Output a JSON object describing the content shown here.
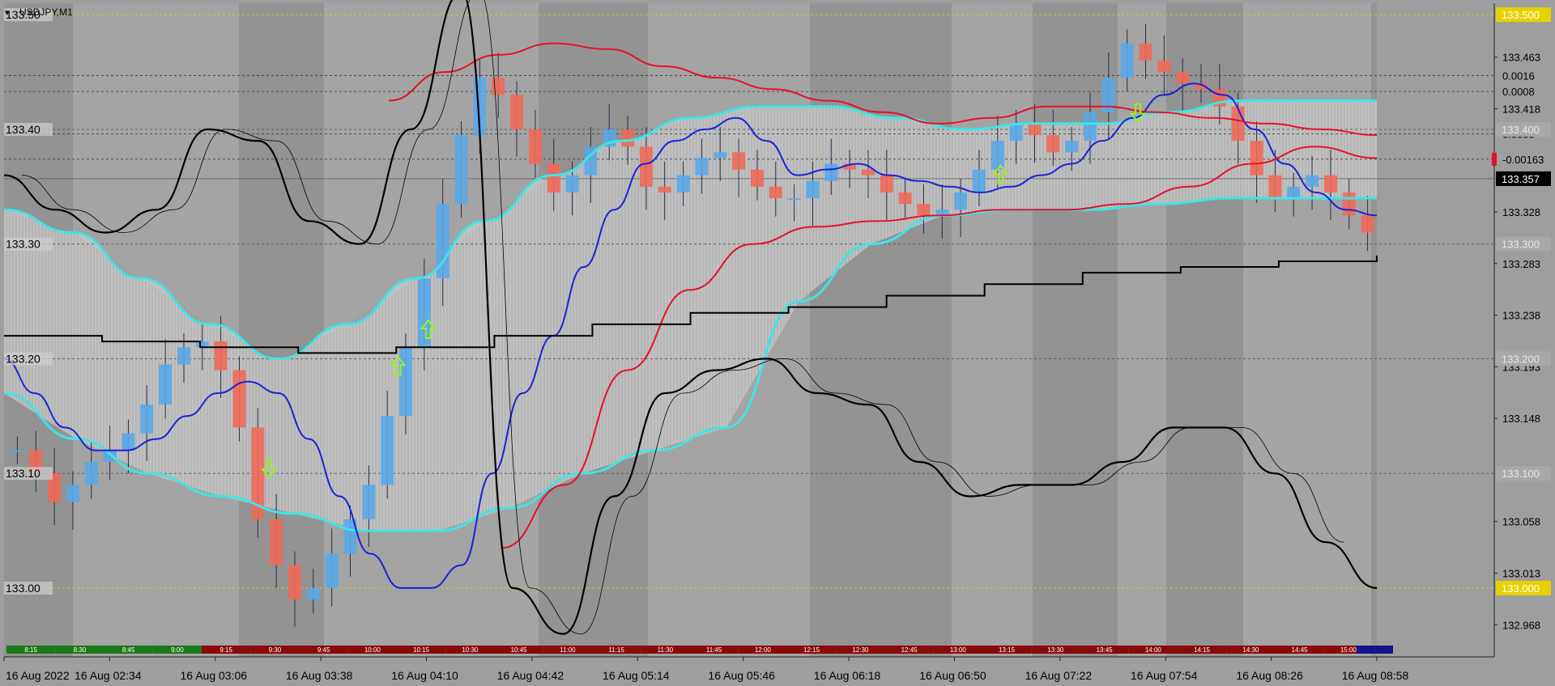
{
  "window": {
    "symbol_label": "USDJPY,M1"
  },
  "colors": {
    "background": "#9e9e9e",
    "session_light": "#a9a9a9",
    "session_dark": "#8a8a8a",
    "band_fill": "#c4c4c4",
    "envelope": "#3fe4e6",
    "price_line": "#000000",
    "ma_red": "#e8102a",
    "ma_blue": "#1a22d8",
    "bull_candle": "#5aa8e8",
    "bear_candle": "#f06a5a",
    "candle_wick": "#2a2a4a",
    "arrow": "#9bf024",
    "level_yellow": "#e6d200",
    "timebar_green": "#1a7a1a",
    "timebar_red": "#8a0a0a",
    "timebar_blue": "#14148a"
  },
  "price_axis": {
    "min": 132.94,
    "max": 133.51,
    "ticks": [
      "133.463",
      "133.418",
      "133.328",
      "133.283",
      "133.238",
      "133.193",
      "133.148",
      "133.058",
      "133.013",
      "132.968"
    ],
    "boxed_levels": [
      {
        "value": 133.5,
        "text": "133.500",
        "style": "yellow"
      },
      {
        "value": 133.4,
        "text": "133.400",
        "style": "gray"
      },
      {
        "value": 133.357,
        "text": "133.357",
        "style": "current"
      },
      {
        "value": 133.3,
        "text": "133.300",
        "style": "gray"
      },
      {
        "value": 133.2,
        "text": "133.200",
        "style": "gray"
      },
      {
        "value": 133.1,
        "text": "133.100",
        "style": "gray"
      },
      {
        "value": 133.0,
        "text": "133.000",
        "style": "yellow"
      }
    ],
    "extra_labels": [
      {
        "value": 133.447,
        "text": "0.0016"
      },
      {
        "value": 133.433,
        "text": "0.0008"
      },
      {
        "value": 133.396,
        "text": "0.0008"
      },
      {
        "value": 133.374,
        "text": "-0.00163"
      }
    ]
  },
  "left_levels": [
    {
      "value": 133.5,
      "text": "133.50"
    },
    {
      "value": 133.4,
      "text": "133.40"
    },
    {
      "value": 133.3,
      "text": "133.30"
    },
    {
      "value": 133.2,
      "text": "133.20"
    },
    {
      "value": 133.1,
      "text": "133.10"
    },
    {
      "value": 133.0,
      "text": "133.00"
    }
  ],
  "time_axis": {
    "labels": [
      "16 Aug 2022",
      "16 Aug 02:34",
      "16 Aug 03:06",
      "16 Aug 03:38",
      "16 Aug 04:10",
      "16 Aug 04:42",
      "16 Aug 05:14",
      "16 Aug 05:46",
      "16 Aug 06:18",
      "16 Aug 06:50",
      "16 Aug 07:22",
      "16 Aug 07:54",
      "16 Aug 08:26",
      "16 Aug 08:58"
    ],
    "session_bar_labels": [
      "8:15",
      "8:30",
      "8:45",
      "9:00",
      "9:15",
      "9:30",
      "9:45",
      "10:00",
      "10:15",
      "10:30",
      "10:45",
      "11:00",
      "11:15",
      "11:30",
      "11:45",
      "12:00",
      "12:15",
      "12:30",
      "12:45",
      "13:00",
      "13:15",
      "13:30",
      "13:45",
      "14:00",
      "14:15",
      "14:30",
      "14:45",
      "15:00"
    ]
  },
  "chart_data": {
    "type": "line",
    "symbol": "USDJPY",
    "timeframe": "M1",
    "ylim": [
      132.94,
      133.51
    ],
    "series": [
      {
        "kind": "close",
        "values": [
          133.12,
          133.1,
          133.075,
          133.09,
          133.11,
          133.12,
          133.135,
          133.16,
          133.195,
          133.21,
          133.215,
          133.19,
          133.14,
          133.06,
          133.02,
          132.99,
          133.0,
          133.03,
          133.06,
          133.09,
          133.15,
          133.21,
          133.27,
          133.335,
          133.395,
          133.445,
          133.43,
          133.4,
          133.37,
          133.345,
          133.36,
          133.385,
          133.4,
          133.385,
          133.35,
          133.345,
          133.36,
          133.375,
          133.38,
          133.365,
          133.35,
          133.34,
          133.34,
          133.355,
          133.37,
          133.365,
          133.36,
          133.345,
          133.335,
          133.325,
          133.33,
          133.345,
          133.365,
          133.39,
          133.405,
          133.395,
          133.38,
          133.39,
          133.415,
          133.445,
          133.475,
          133.46,
          133.45,
          133.44,
          133.435,
          133.42,
          133.39,
          133.36,
          133.34,
          133.35,
          133.36,
          133.345,
          133.325,
          133.31
        ]
      },
      {
        "kind": "moving_average_blue",
        "values": [
          133.2,
          133.17,
          133.14,
          133.12,
          133.12,
          133.13,
          133.15,
          133.17,
          133.18,
          133.17,
          133.13,
          133.08,
          133.03,
          133.0,
          133.0,
          133.02,
          133.1,
          133.17,
          133.22,
          133.28,
          133.33,
          133.37,
          133.39,
          133.4,
          133.41,
          133.39,
          133.36,
          133.365,
          133.37,
          133.36,
          133.355,
          133.35,
          133.345,
          133.35,
          133.36,
          133.37,
          133.39,
          133.41,
          133.43,
          133.44,
          133.43,
          133.4,
          133.37,
          133.345,
          133.33,
          133.325
        ]
      },
      {
        "kind": "moving_average_red_upper",
        "values": [
          133.425,
          133.45,
          133.465,
          133.475,
          133.47,
          133.455,
          133.445,
          133.435,
          133.425,
          133.415,
          133.405,
          133.41,
          133.42,
          133.42,
          133.415,
          133.41,
          133.405,
          133.4,
          133.395
        ]
      },
      {
        "kind": "moving_average_red_lower",
        "values": [
          133.035,
          133.09,
          133.19,
          133.26,
          133.3,
          133.315,
          133.32,
          133.325,
          133.33,
          133.33,
          133.335,
          133.35,
          133.37,
          133.385,
          133.375
        ]
      },
      {
        "kind": "envelope_upper",
        "values": [
          133.33,
          133.31,
          133.27,
          133.23,
          133.2,
          133.23,
          133.27,
          133.32,
          133.36,
          133.39,
          133.41,
          133.42,
          133.42,
          133.41,
          133.4,
          133.405,
          133.405,
          133.415,
          133.425,
          133.425,
          133.425
        ]
      },
      {
        "kind": "envelope_lower",
        "values": [
          133.17,
          133.13,
          133.1,
          133.08,
          133.065,
          133.05,
          133.05,
          133.07,
          133.1,
          133.12,
          133.14,
          133.25,
          133.3,
          133.325,
          133.33,
          133.33,
          133.335,
          133.34,
          133.34,
          133.34
        ]
      },
      {
        "kind": "trend_step",
        "values": [
          133.22,
          133.215,
          133.21,
          133.205,
          133.21,
          133.22,
          133.23,
          133.24,
          133.245,
          133.255,
          133.265,
          133.275,
          133.28,
          133.285,
          133.29
        ]
      },
      {
        "kind": "oscillator_black",
        "values": [
          133.36,
          133.33,
          133.31,
          133.33,
          133.4,
          133.39,
          133.32,
          133.3,
          133.4,
          133.52,
          133.0,
          132.96,
          133.08,
          133.17,
          133.19,
          133.2,
          133.17,
          133.16,
          133.11,
          133.08,
          133.09,
          133.09,
          133.11,
          133.14,
          133.14,
          133.1,
          133.04,
          133.0
        ]
      }
    ],
    "signal_arrows": [
      {
        "direction": "down",
        "x_frac": 0.193,
        "value": 133.105
      },
      {
        "direction": "up",
        "x_frac": 0.287,
        "value": 133.193
      },
      {
        "direction": "up",
        "x_frac": 0.309,
        "value": 133.225
      },
      {
        "direction": "up",
        "x_frac": 0.726,
        "value": 133.36
      },
      {
        "direction": "down",
        "x_frac": 0.826,
        "value": 133.415
      }
    ]
  }
}
